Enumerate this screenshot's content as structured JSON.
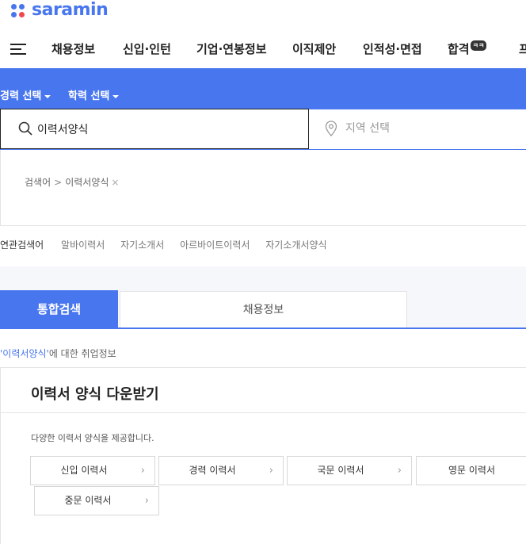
{
  "logo": {
    "text": "saramin"
  },
  "gnb": {
    "items": [
      "채용정보",
      "신입·인턴",
      "기업·연봉정보",
      "이직제안",
      "인적성·면접",
      "합격",
      "프"
    ],
    "badge": "ㅋㅋ"
  },
  "filters": {
    "career": "경력 선택",
    "education": "학력 선택"
  },
  "search": {
    "value": "이력서양식",
    "region_placeholder": "지역 선택"
  },
  "keyword": {
    "label": "검색어",
    "sep": ">",
    "term": "이력서양식",
    "remove": "×"
  },
  "related": {
    "head": "연관검색어",
    "items": [
      "알바이력서",
      "자기소개서",
      "아르바이트이력서",
      "자기소개서양식"
    ]
  },
  "tabs": {
    "active": "통합검색",
    "normal": "채용정보"
  },
  "info": {
    "query": "'이력서양식'",
    "suffix": "에 대한 취업정보"
  },
  "card": {
    "title": "이력서 양식 다운받기",
    "desc": "다양한 이력서 양식을 제공합니다.",
    "buttons": [
      "신입 이력서",
      "경력 이력서",
      "국문 이력서",
      "영문 이력서",
      "중문 이력서"
    ],
    "chevron": "›"
  },
  "colors": {
    "brand": "#4876ef"
  }
}
